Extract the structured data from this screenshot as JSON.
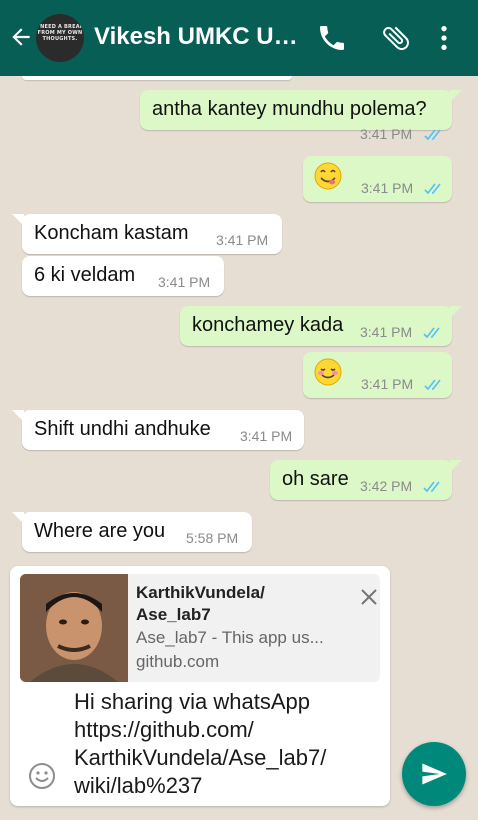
{
  "header": {
    "avatar_text": "I NEED A BREAK FROM MY OWN THOUGHTS.",
    "title": "Vikesh UMKC Us...",
    "icons": [
      "back-arrow-icon",
      "call-icon",
      "attach-icon",
      "more-vert-icon"
    ]
  },
  "messages": [
    {
      "dir": "out",
      "text": "antha kantey mundhu polema?",
      "time": "3:41 PM",
      "status": "read"
    },
    {
      "dir": "out",
      "emoji": "yum-face",
      "text": "",
      "time": "3:41 PM",
      "status": "read"
    },
    {
      "dir": "in",
      "text": "Koncham kastam",
      "time": "3:41 PM"
    },
    {
      "dir": "in",
      "text": "6 ki veldam",
      "time": "3:41 PM"
    },
    {
      "dir": "out",
      "text": "konchamey kada",
      "time": "3:41 PM",
      "status": "read"
    },
    {
      "dir": "out",
      "emoji": "smiling-blush-face",
      "text": "",
      "time": "3:41 PM",
      "status": "read"
    },
    {
      "dir": "in",
      "text": "Shift undhi andhuke",
      "time": "3:41 PM"
    },
    {
      "dir": "out",
      "text": "oh sare",
      "time": "3:42 PM",
      "status": "read"
    },
    {
      "dir": "in",
      "text": "Where are you",
      "time": "5:58 PM"
    }
  ],
  "composer": {
    "link_preview": {
      "title": "KarthikVundela/ Ase_lab7",
      "description": "Ase_lab7 - This app us...",
      "domain": "github.com"
    },
    "text": "Hi sharing via whatsApp https://github.com/ KarthikVundela/Ase_lab7/ wiki/lab%237"
  },
  "colors": {
    "header": "#075e54",
    "outgoing_bubble": "#dcf8c6",
    "incoming_bubble": "#ffffff",
    "read_ticks": "#4fc3f7",
    "send_button": "#00897b",
    "background": "#e6ddd3"
  }
}
